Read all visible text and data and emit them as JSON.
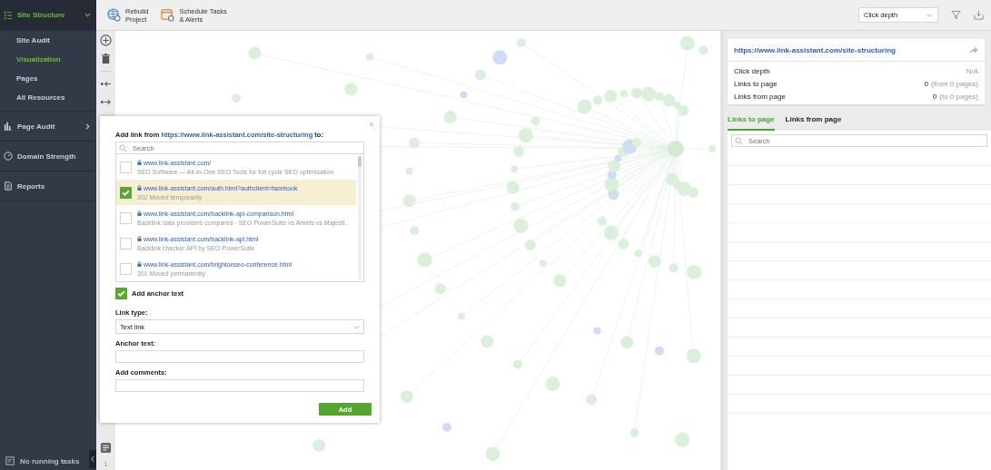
{
  "sidebar": {
    "sections": [
      {
        "label": "Site Structure",
        "kind": "group",
        "expanded": true,
        "selected": true,
        "children": [
          {
            "label": "Site Audit",
            "selected": false
          },
          {
            "label": "Visualization",
            "selected": true
          },
          {
            "label": "Pages",
            "selected": false
          },
          {
            "label": "All Resources",
            "selected": false
          }
        ]
      },
      {
        "label": "Page Audit",
        "kind": "group",
        "expanded": false,
        "selected": false
      },
      {
        "label": "Domain Strength",
        "kind": "link",
        "selected": false
      },
      {
        "label": "Reports",
        "kind": "link",
        "selected": false
      }
    ],
    "footer": "No running tasks"
  },
  "toolbar": {
    "buttons": [
      {
        "lines": [
          "Rebuild",
          "Project"
        ]
      },
      {
        "lines": [
          "Schedule Tasks",
          "& Alerts"
        ]
      }
    ],
    "view_select": "Click depth"
  },
  "tool_column": {
    "counter": "1"
  },
  "dialog": {
    "title_prefix": "Add link from",
    "title_url": "https://www.link-assistant.com/site-structuring",
    "title_suffix": "to:",
    "search_placeholder": "Search",
    "results": [
      {
        "url": "www.link-assistant.com/",
        "description": "SEO Software — All-In-One SEO Tools for full cycle SEO optimisation",
        "checked": false
      },
      {
        "url": "www.link-assistant.com/auth.html?authclient=facebook",
        "description": "302 Moved temporarily",
        "checked": true
      },
      {
        "url": "www.link-assistant.com/backlink-api-comparison.html",
        "description": "Backlink data providers compared - SEO PowerSuite vs Ahrefs vs Majesti...",
        "checked": false
      },
      {
        "url": "www.link-assistant.com/backlink-api.html",
        "description": "Backlink checker API by SEO PowerSuite",
        "checked": false
      },
      {
        "url": "www.link-assistant.com/brightonseo-conference.html",
        "description": "301 Moved permanently",
        "checked": false
      }
    ],
    "add_anchor_text": {
      "label": "Add anchor text",
      "checked": true
    },
    "link_type_label": "Link type:",
    "link_type": "Text link",
    "anchor_label": "Anchor text:",
    "comments_label": "Add comments:",
    "add_button": "Add"
  },
  "details": {
    "page_url": "https://www.link-assistant.com/site-structuring",
    "stats": [
      {
        "label": "Click depth",
        "value": "N/A"
      },
      {
        "label": "Links to page",
        "value": "0",
        "note": "(from 0 pages)"
      },
      {
        "label": "Links from page",
        "value": "0",
        "note": "(to 0 pages)"
      }
    ],
    "tabs": [
      {
        "label": "Links to page",
        "selected": true
      },
      {
        "label": "Links from page",
        "selected": false
      }
    ],
    "search_placeholder": "Search"
  }
}
